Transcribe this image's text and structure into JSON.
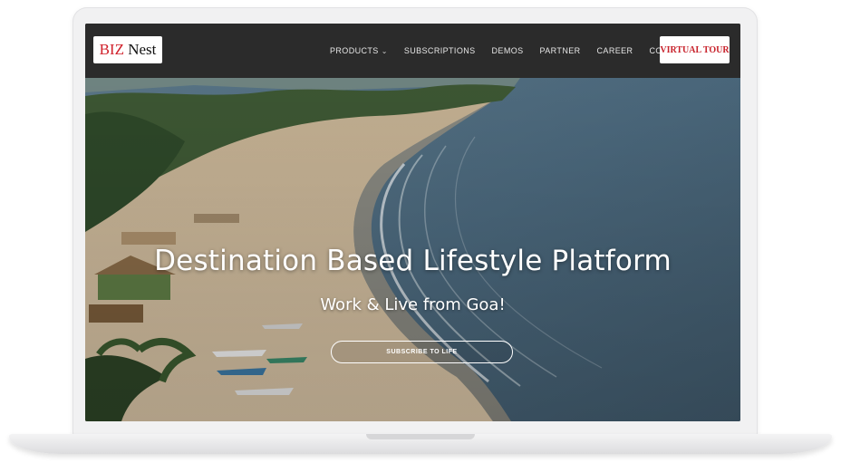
{
  "navbar": {
    "logo": {
      "part1": "BIZ",
      "part2": " Nest"
    },
    "items": [
      {
        "label": "PRODUCTS",
        "has_dropdown": true
      },
      {
        "label": "SUBSCRIPTIONS"
      },
      {
        "label": "DEMOS"
      },
      {
        "label": "PARTNER"
      },
      {
        "label": "CAREER"
      },
      {
        "label": "CONTACT"
      }
    ],
    "cta_label": "VIRTUAL TOUR"
  },
  "hero": {
    "title": "Destination Based Lifestyle Platform",
    "subtitle": "Work & Live from Goa!",
    "button_label": "SUBSCRIBE TO LIFE"
  },
  "colors": {
    "navbar_bg": "#2b2b2b",
    "brand_red": "#c8232c",
    "sea": "#4f6e84",
    "sand": "#cdb79a"
  },
  "icons": {
    "dropdown": "chevron-down-icon"
  }
}
